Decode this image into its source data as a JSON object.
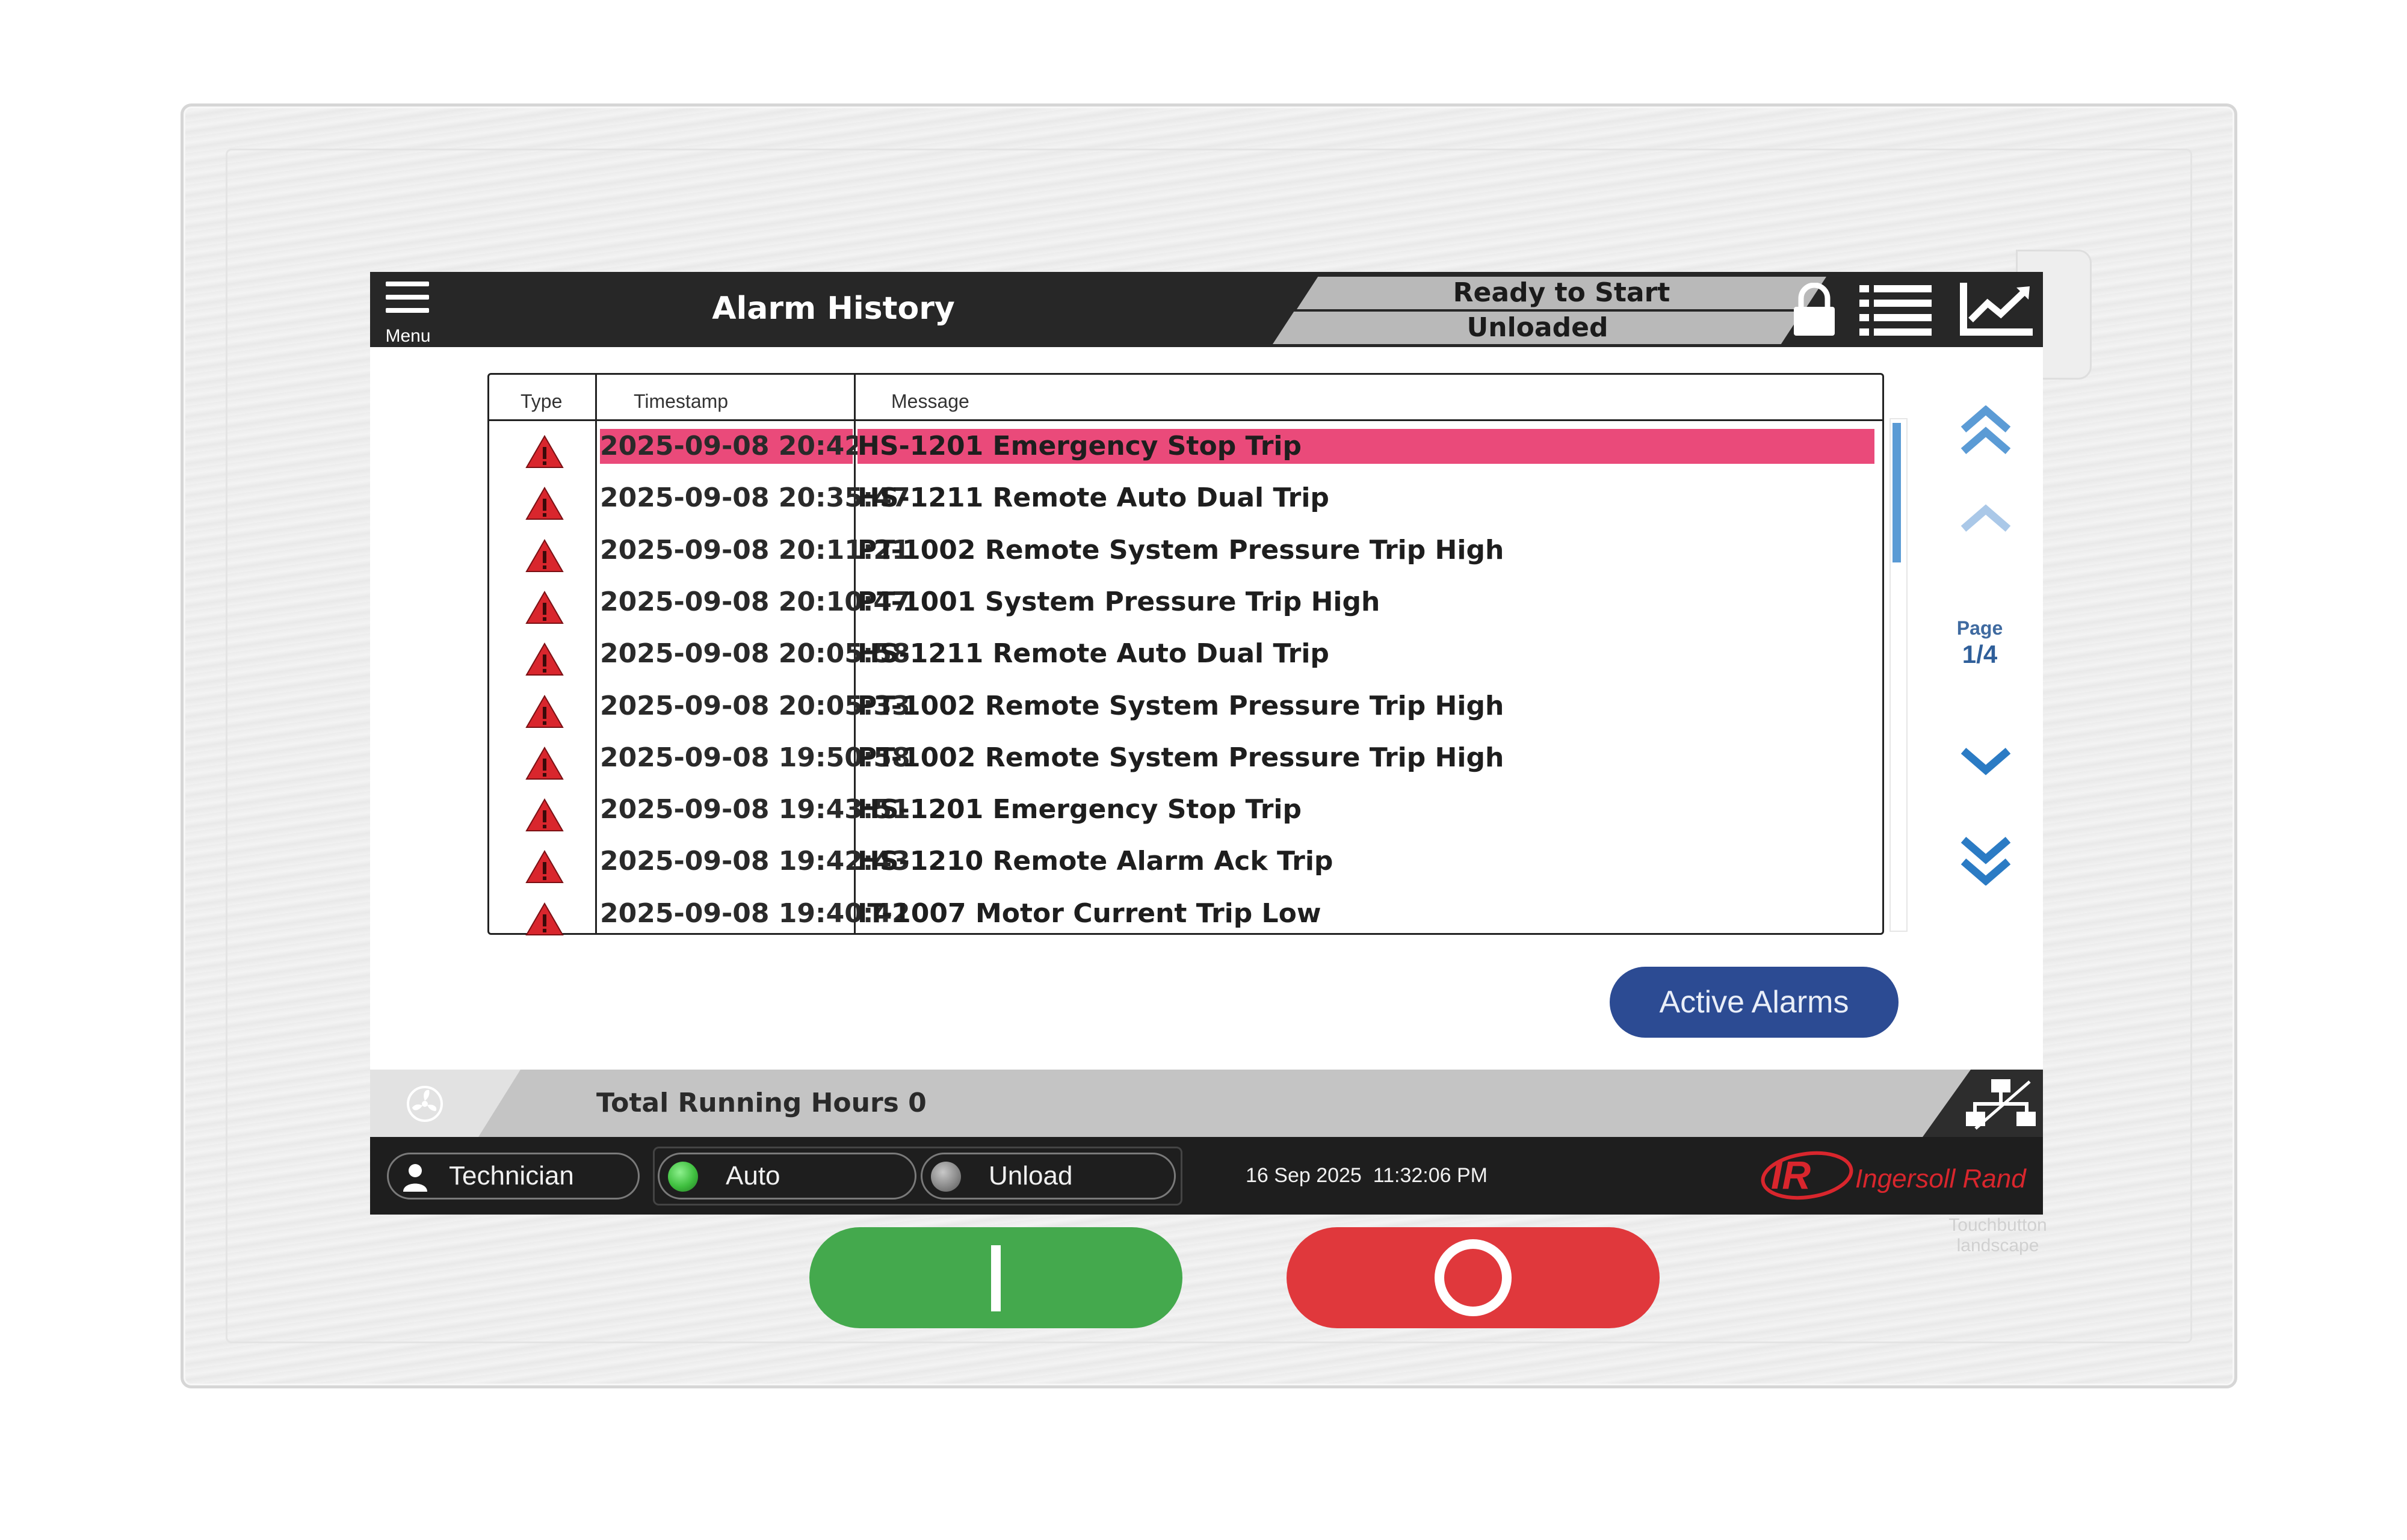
{
  "header": {
    "menu_label": "Menu",
    "title": "Alarm History",
    "status_line1": "Ready to Start",
    "status_line2": "Unloaded",
    "icons": [
      "lock-icon",
      "list-icon",
      "trend-chart-icon"
    ]
  },
  "table": {
    "columns": [
      "Type",
      "Timestamp",
      "Message"
    ],
    "rows": [
      {
        "type": "warning-triangle-icon",
        "timestamp": "2025-09-08 20:42:07",
        "message": "HS-1201 Emergency Stop Trip",
        "selected": true
      },
      {
        "type": "warning-triangle-icon",
        "timestamp": "2025-09-08 20:35:47",
        "message": "HS-1211 Remote Auto Dual Trip"
      },
      {
        "type": "warning-triangle-icon",
        "timestamp": "2025-09-08 20:11:21",
        "message": "PT-1002 Remote System Pressure Trip High"
      },
      {
        "type": "warning-triangle-icon",
        "timestamp": "2025-09-08 20:10:47",
        "message": "PT-1001 System Pressure Trip High"
      },
      {
        "type": "warning-triangle-icon",
        "timestamp": "2025-09-08 20:05:58",
        "message": "HS-1211 Remote Auto Dual Trip"
      },
      {
        "type": "warning-triangle-icon",
        "timestamp": "2025-09-08 20:05:33",
        "message": "PT-1002 Remote System Pressure Trip High"
      },
      {
        "type": "warning-triangle-icon",
        "timestamp": "2025-09-08 19:50:58",
        "message": "PT-1002 Remote System Pressure Trip High"
      },
      {
        "type": "warning-triangle-icon",
        "timestamp": "2025-09-08 19:43:51",
        "message": "HS-1201 Emergency Stop Trip"
      },
      {
        "type": "warning-triangle-icon",
        "timestamp": "2025-09-08 19:42:43",
        "message": "HS-1210 Remote Alarm Ack Trip"
      },
      {
        "type": "warning-triangle-icon",
        "timestamp": "2025-09-08 19:40:42",
        "message": "IT-1007 Motor Current Trip Low"
      }
    ]
  },
  "pagination": {
    "label": "Page",
    "value": "1/4"
  },
  "active_alarms_label": "Active Alarms",
  "running_hours": "Total Running Hours 0",
  "statusbar": {
    "user": "Technician",
    "mode": "Auto",
    "load_state": "Unload",
    "datetime": "16 Sep 2025  11:32:06 PM",
    "brand": "Ingersoll Rand",
    "brand_mark": "IR"
  },
  "device_watermark": [
    "Touchbutton",
    "landscape"
  ],
  "colors": {
    "selected_row": "#ea4a7a",
    "alarm_triangle": "#d9262d",
    "accent_blue": "#5b9bd5",
    "active_alarms_button": "#2c4b93",
    "start_button": "#44a94d",
    "stop_button": "#e0383c",
    "auto_indicator": "#3fbf3f",
    "unload_indicator": "#8a8a8a",
    "brand_red": "#d9262d"
  }
}
